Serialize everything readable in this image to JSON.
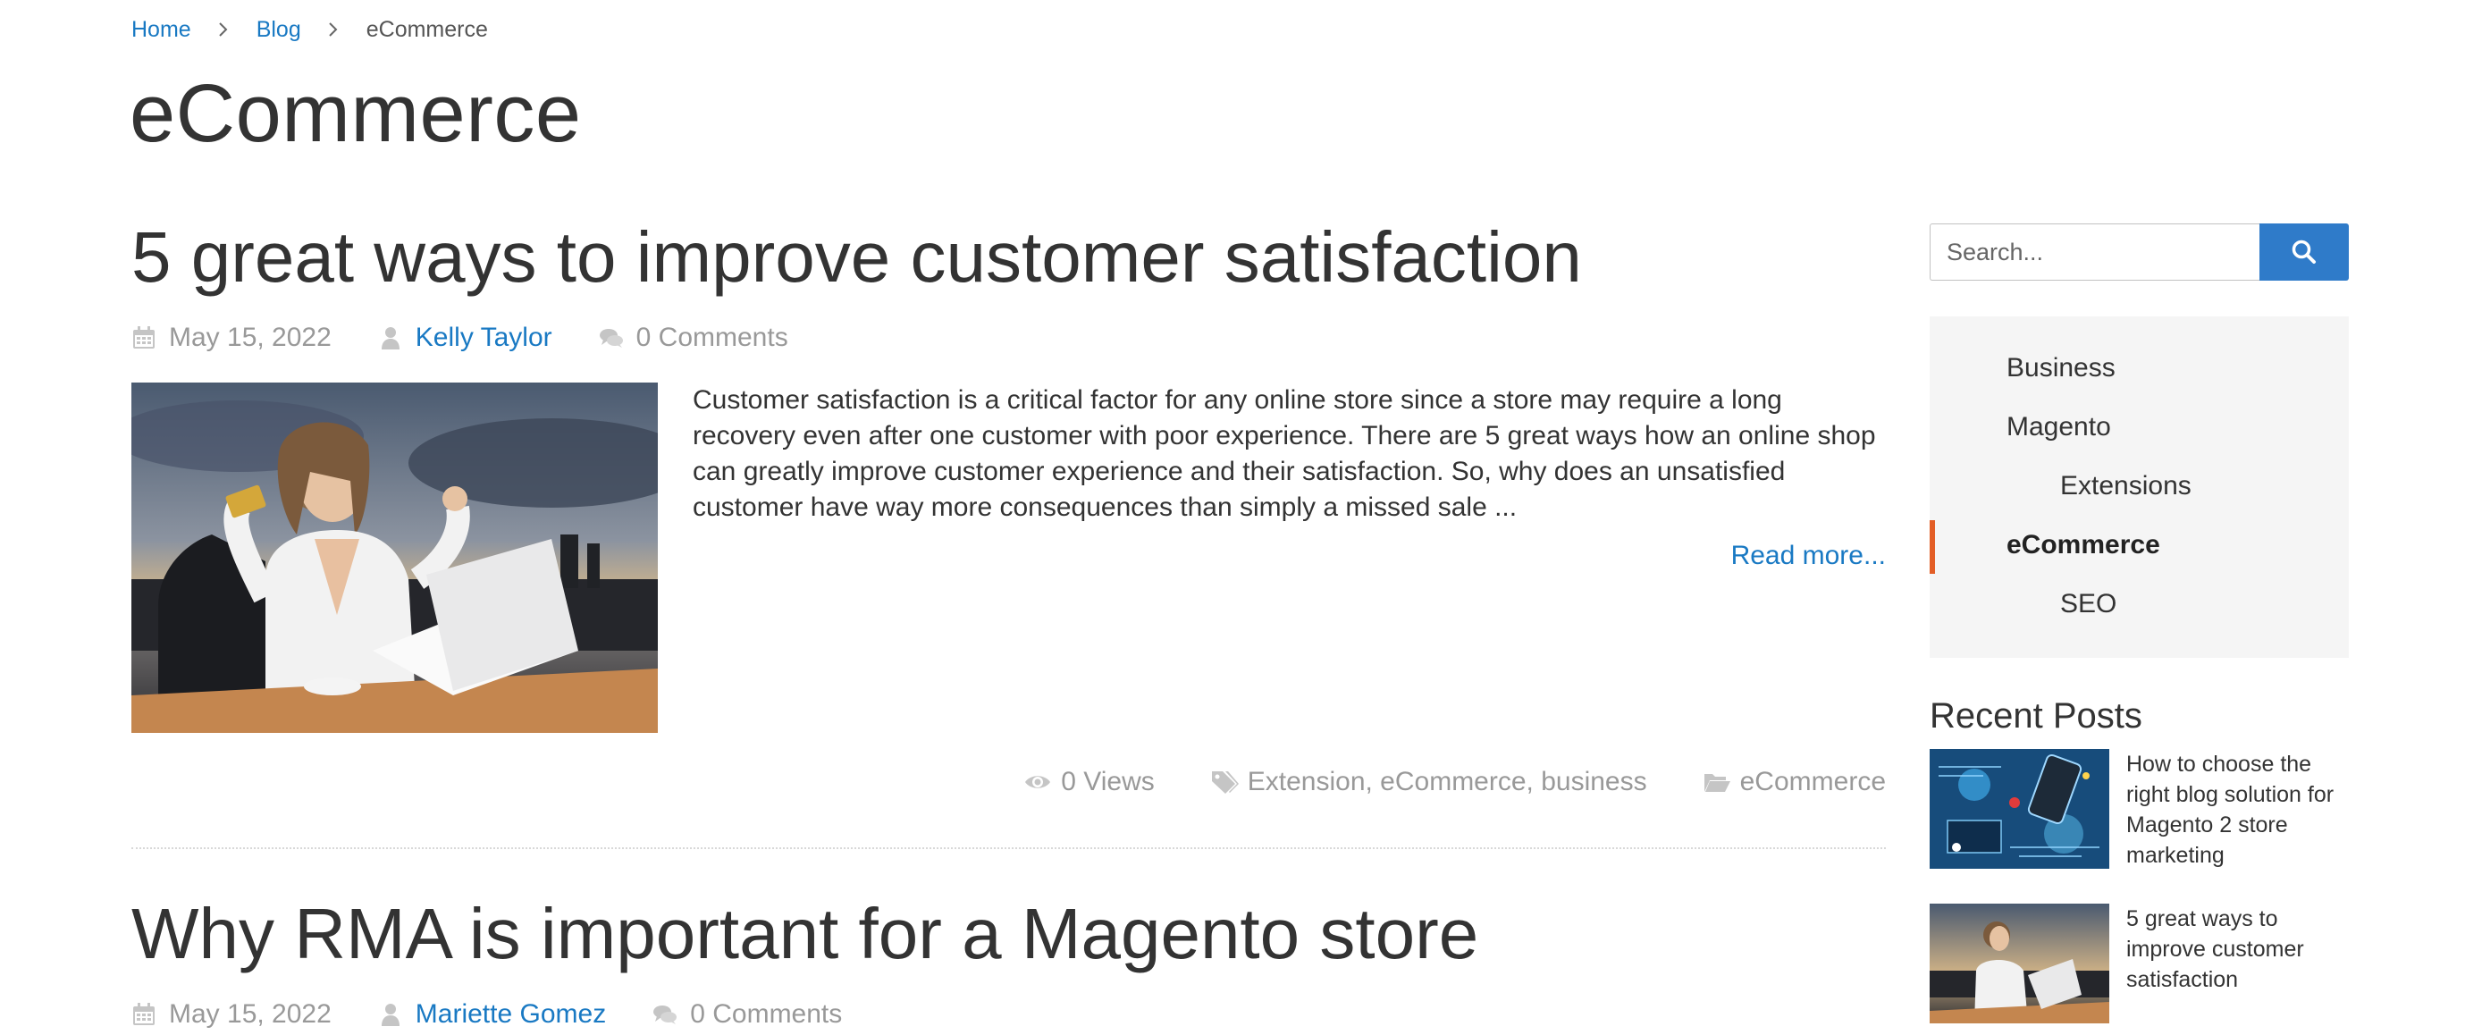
{
  "breadcrumb": {
    "home": "Home",
    "blog": "Blog",
    "current": "eCommerce"
  },
  "page": {
    "title": "eCommerce"
  },
  "posts": [
    {
      "title": "5 great ways to improve customer satisfaction",
      "date": "May 15, 2022",
      "author": "Kelly Taylor",
      "comments": "0 Comments",
      "excerpt": "Customer satisfaction is a critical factor for any online store since a store may require a long recovery even after one customer with poor experience. There are 5 great ways how an online shop can greatly improve customer experience and their satisfaction. So, why does an unsatisfied customer have way more consequences than simply a missed sale ...",
      "read_more": "Read more...",
      "views": "0 Views",
      "tags": "Extension, eCommerce, business",
      "category": "eCommerce"
    },
    {
      "title": "Why RMA is important for a Magento store",
      "date": "May 15, 2022",
      "author": "Mariette Gomez",
      "comments": "0 Comments"
    }
  ],
  "sidebar": {
    "search_placeholder": "Search...",
    "categories": [
      {
        "label": "Business"
      },
      {
        "label": "Magento"
      },
      {
        "label": "Extensions"
      },
      {
        "label": "eCommerce"
      },
      {
        "label": "SEO"
      }
    ],
    "active_category": "eCommerce",
    "recent_posts_title": "Recent Posts",
    "recent_posts": [
      {
        "title": "How to choose the right blog solution for Magento 2 store marketing"
      },
      {
        "title": "5 great ways to improve customer satisfaction"
      }
    ]
  },
  "colors": {
    "link": "#1979c3",
    "search_button": "#2f7bc9",
    "active_marker": "#e35e26",
    "sidebar_bg": "#f5f5f5"
  },
  "icons": [
    "chevron-right-icon",
    "calendar-icon",
    "user-icon",
    "comments-icon",
    "eye-icon",
    "tags-icon",
    "folder-open-icon",
    "search-icon"
  ]
}
